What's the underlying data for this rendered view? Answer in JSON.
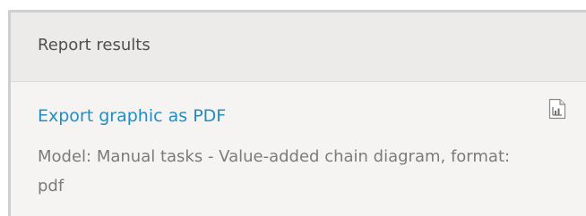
{
  "panel": {
    "title": "Report results"
  },
  "results": [
    {
      "link_text": "Export graphic as PDF",
      "description": "Model: Manual tasks - Value-added chain diagram, format: pdf",
      "icon": "report-chart-icon"
    }
  ]
}
